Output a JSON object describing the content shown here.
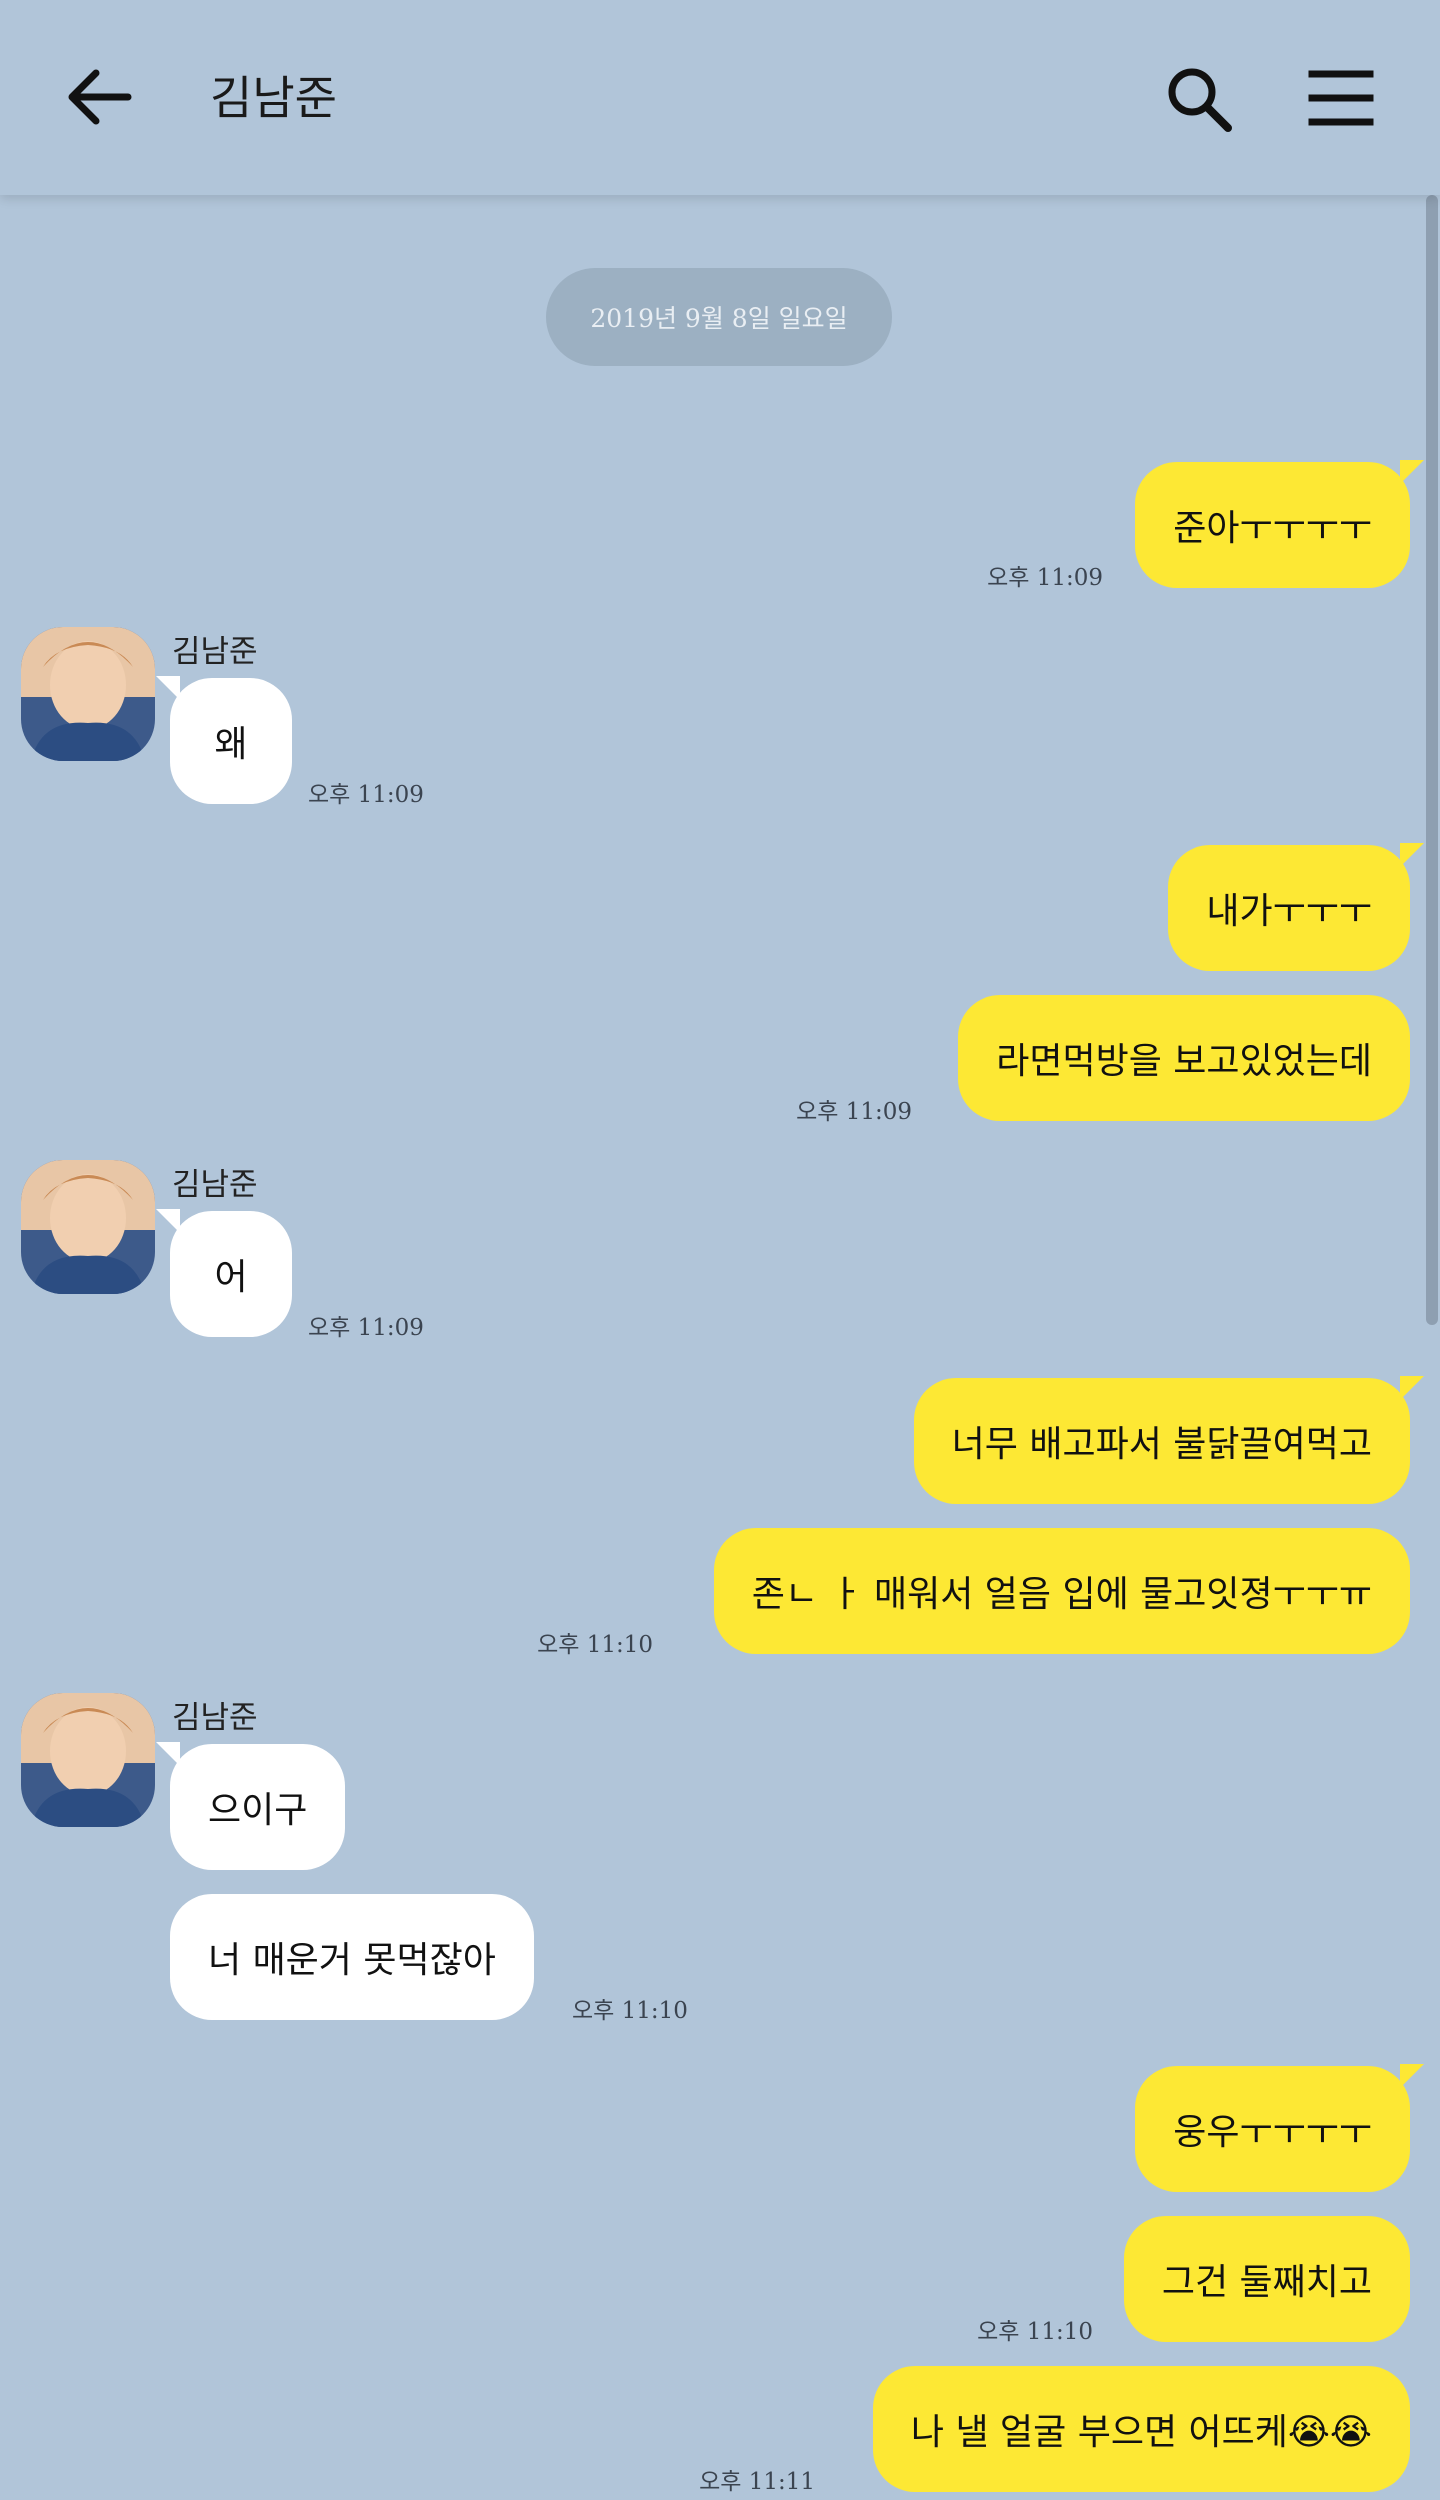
{
  "header": {
    "title": "김남준",
    "back_icon": "arrow-left-icon",
    "search_icon": "search-icon",
    "menu_icon": "hamburger-menu-icon"
  },
  "date_divider": "2019년 9월 8일 일요일",
  "contact": {
    "name": "김남준"
  },
  "messages": [
    {
      "from": "me",
      "text": "준아ㅜㅜㅜㅜ",
      "time": "오후 11:09"
    },
    {
      "from": "other",
      "text": "왜",
      "time": "오후 11:09"
    },
    {
      "from": "me",
      "text": "내가ㅜㅜㅜ",
      "time": ""
    },
    {
      "from": "me",
      "text": "라면먹방을 보고있었는데",
      "time": "오후 11:09"
    },
    {
      "from": "other",
      "text": "어",
      "time": "오후 11:09"
    },
    {
      "from": "me",
      "text": "너무 배고파서 불닭끌여먹고",
      "time": ""
    },
    {
      "from": "me",
      "text": "존ㄴ ㅏ 매워서 얼음 입에 물고잇졍ㅜㅜㅠ",
      "time": "오후 11:10"
    },
    {
      "from": "other",
      "text": "으이구",
      "time": ""
    },
    {
      "from": "other",
      "text": "너 매운거 못먹잖아",
      "time": "오후 11:10"
    },
    {
      "from": "me",
      "text": "웅우ㅜㅜㅜㅜ",
      "time": ""
    },
    {
      "from": "me",
      "text": "그건 둘째치고",
      "time": "오후 11:10"
    },
    {
      "from": "me",
      "text": "나 낼 얼굴 부으면 어뜨케😭😭",
      "time": "오후 11:11"
    }
  ],
  "colors": {
    "background": "#b1c5d9",
    "my_bubble": "#fde834",
    "other_bubble": "#ffffff",
    "date_pill": "#9cb0c2"
  }
}
